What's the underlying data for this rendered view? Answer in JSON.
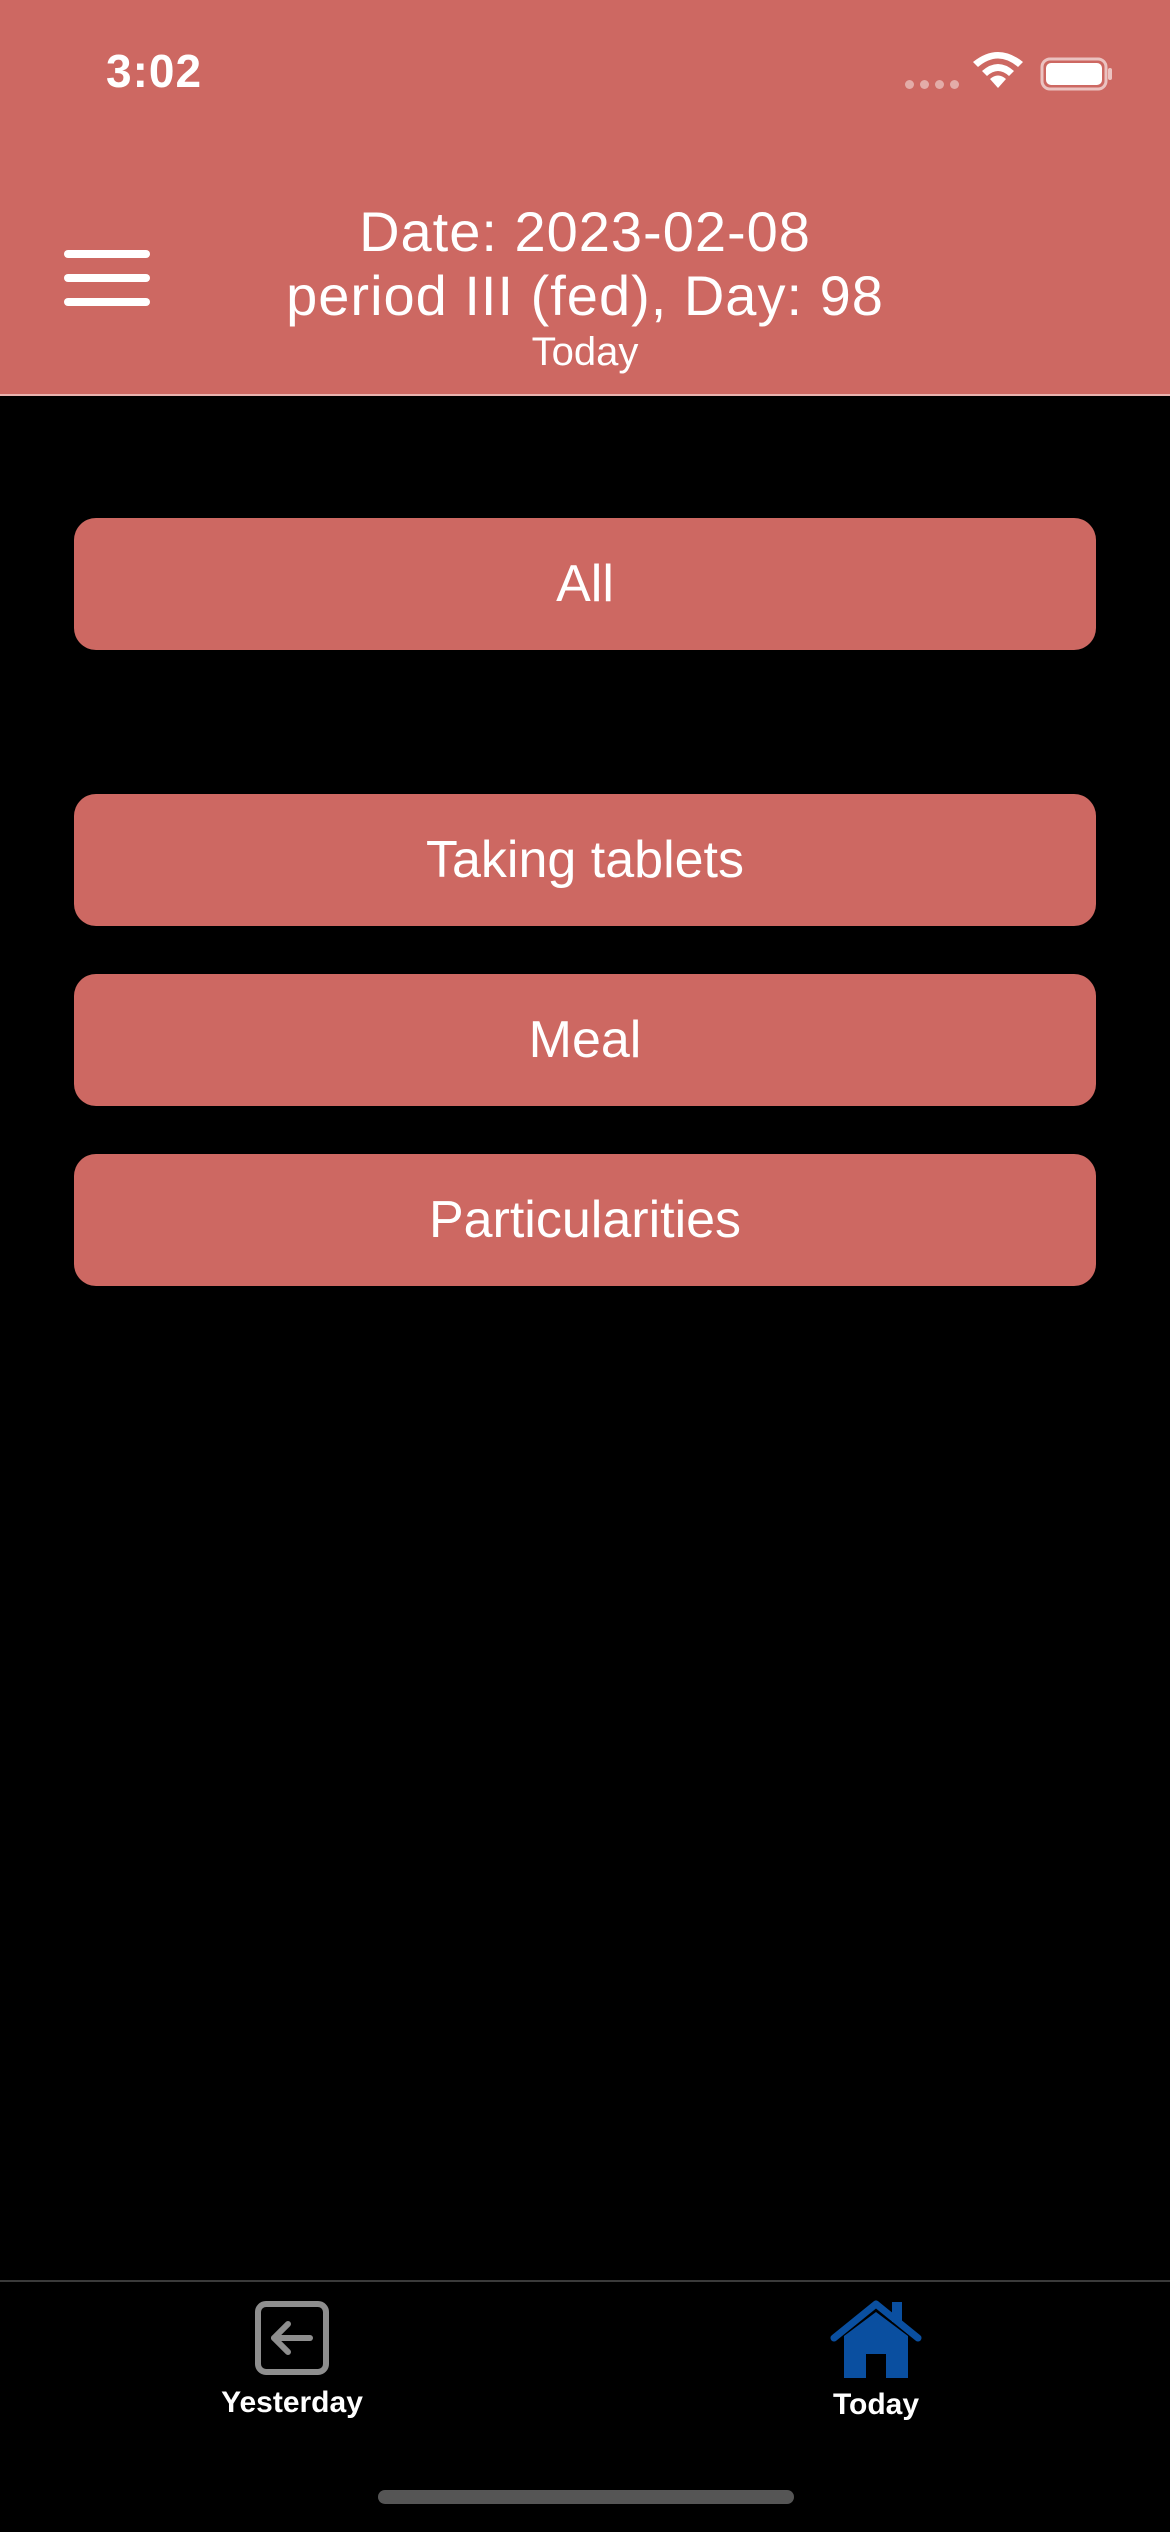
{
  "status_bar": {
    "time": "3:02"
  },
  "header": {
    "date_line": "Date: 2023-02-08",
    "period_line": "period III (fed), Day: 98",
    "sub_label": "Today",
    "background_color": "#CD6862"
  },
  "buttons": {
    "all": "All",
    "taking_tablets": "Taking tablets",
    "meal": "Meal",
    "particularities": "Particularities"
  },
  "tab_bar": {
    "yesterday_label": "Yesterday",
    "today_label": "Today",
    "active_tab": "Today",
    "active_color": "#0A4FA0"
  },
  "icons": {
    "menu": "hamburger-menu-icon",
    "yesterday": "arrow-left-square-icon",
    "today": "home-icon"
  }
}
